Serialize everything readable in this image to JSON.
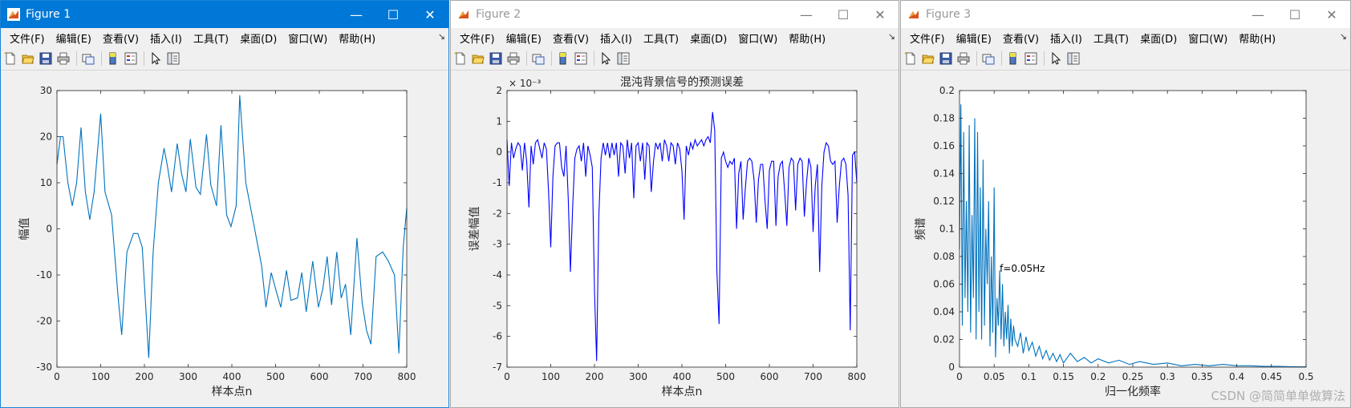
{
  "menu_labels": [
    "文件(F)",
    "编辑(E)",
    "查看(V)",
    "插入(I)",
    "工具(T)",
    "桌面(D)",
    "窗口(W)",
    "帮助(H)"
  ],
  "toolbar_icons": [
    "new-figure-icon",
    "open-file-icon",
    "save-icon",
    "print-icon",
    "link-plot-icon",
    "colorbar-icon",
    "legend-icon",
    "pointer-icon",
    "property-editor-icon"
  ],
  "colors": {
    "active_title": "#0078d7",
    "figure_bg": "#f0f0f0",
    "line_matlab": "#0072bd",
    "line_blue": "#0000ff"
  },
  "watermark": "CSDN @简简单单做算法",
  "windows": [
    {
      "title": "Figure 1",
      "active": true
    },
    {
      "title": "Figure 2",
      "active": false
    },
    {
      "title": "Figure 3",
      "active": false
    }
  ],
  "chart_data": [
    {
      "type": "line",
      "title": "",
      "xlabel": "样本点n",
      "ylabel": "幅值",
      "xlim": [
        0,
        800
      ],
      "ylim": [
        -30,
        30
      ],
      "xticks": [
        "0",
        "100",
        "200",
        "300",
        "400",
        "500",
        "600",
        "700",
        "800"
      ],
      "yticks": [
        "-30",
        "-20",
        "-10",
        "0",
        "10",
        "20",
        "30"
      ],
      "grid": false,
      "color": "#0072bd",
      "x": [
        0,
        8,
        14,
        25,
        35,
        45,
        55,
        65,
        75,
        85,
        100,
        110,
        125,
        140,
        148,
        160,
        175,
        185,
        195,
        210,
        220,
        232,
        245,
        252,
        262,
        275,
        285,
        295,
        305,
        318,
        328,
        342,
        352,
        365,
        375,
        388,
        398,
        410,
        418,
        432,
        450,
        468,
        478,
        490,
        500,
        512,
        525,
        535,
        550,
        560,
        570,
        585,
        598,
        608,
        618,
        628,
        640,
        650,
        660,
        672,
        686,
        698,
        708,
        718,
        730,
        745,
        758,
        772,
        782,
        792,
        800
      ],
      "y": [
        14,
        20,
        20,
        10,
        5,
        10,
        22,
        8,
        2,
        8,
        25,
        8,
        3,
        -15,
        -23,
        -5,
        -1,
        -1,
        -4,
        -28,
        -5,
        10,
        17.5,
        14,
        8,
        18.5,
        12,
        8,
        19.5,
        9,
        7.5,
        20.5,
        9.5,
        5,
        22.5,
        3,
        0.5,
        5,
        29,
        10,
        1,
        -8,
        -17,
        -9.5,
        -13,
        -17,
        -9,
        -15.5,
        -15,
        -9.5,
        -18,
        -7,
        -17,
        -13,
        -6,
        -16.5,
        -5,
        -15,
        -12,
        -23,
        -2,
        -16,
        -22,
        -25,
        -6,
        -5,
        -7,
        -10,
        -27,
        -4,
        4.5
      ]
    },
    {
      "type": "line",
      "title": "混沌背景信号的预测误差",
      "xlabel": "样本点n",
      "ylabel": "误差幅值",
      "exponent_label": "× 10⁻³",
      "xlim": [
        0,
        800
      ],
      "ylim": [
        -7,
        2
      ],
      "xticks": [
        "0",
        "100",
        "200",
        "300",
        "400",
        "500",
        "600",
        "700",
        "800"
      ],
      "yticks": [
        "-7",
        "-6",
        "-5",
        "-4",
        "-3",
        "-2",
        "-1",
        "0",
        "1",
        "2"
      ],
      "grid": false,
      "color": "#0000ff",
      "x": [
        0,
        5,
        10,
        15,
        20,
        25,
        30,
        35,
        40,
        45,
        50,
        55,
        60,
        65,
        70,
        75,
        80,
        85,
        90,
        95,
        100,
        105,
        110,
        115,
        120,
        125,
        130,
        135,
        140,
        145,
        150,
        155,
        160,
        165,
        170,
        175,
        180,
        185,
        190,
        195,
        200,
        205,
        210,
        215,
        220,
        225,
        230,
        235,
        240,
        245,
        250,
        255,
        260,
        265,
        270,
        275,
        280,
        285,
        290,
        295,
        300,
        305,
        310,
        315,
        320,
        325,
        330,
        335,
        340,
        345,
        350,
        355,
        360,
        365,
        370,
        375,
        380,
        385,
        390,
        395,
        400,
        405,
        410,
        415,
        420,
        425,
        430,
        435,
        440,
        445,
        450,
        455,
        460,
        465,
        470,
        475,
        480,
        485,
        490,
        495,
        500,
        505,
        510,
        515,
        520,
        525,
        530,
        535,
        540,
        545,
        550,
        555,
        560,
        565,
        570,
        575,
        580,
        585,
        590,
        595,
        600,
        605,
        610,
        615,
        620,
        625,
        630,
        635,
        640,
        645,
        650,
        655,
        660,
        665,
        670,
        675,
        680,
        685,
        690,
        695,
        700,
        705,
        710,
        715,
        720,
        725,
        730,
        735,
        740,
        745,
        750,
        755,
        760,
        765,
        770,
        775,
        780,
        785,
        790,
        795,
        800
      ],
      "y": [
        0.4,
        -1.1,
        0.3,
        -0.2,
        0.1,
        0.3,
        0.2,
        -0.6,
        0.3,
        -0.3,
        -1.8,
        0.2,
        -0.4,
        0.3,
        0.4,
        0.1,
        -0.2,
        0.3,
        0.1,
        -1.3,
        -3.1,
        -0.8,
        0.2,
        0.3,
        0.3,
        -0.5,
        -0.8,
        0.2,
        -1.5,
        -3.9,
        -1.8,
        -0.2,
        0.1,
        0.2,
        -0.3,
        0.3,
        -0.8,
        0.2,
        -0.1,
        -0.5,
        -4.5,
        -6.8,
        -2.1,
        -0.2,
        0.3,
        -0.1,
        0.3,
        -0.2,
        0.3,
        -0.1,
        0.3,
        -0.8,
        0.3,
        0.2,
        -0.7,
        0.4,
        -0.2,
        0.3,
        -1.5,
        0.2,
        0.3,
        -0.3,
        0.3,
        -0.9,
        0.3,
        0.2,
        -1.3,
        -0.3,
        0.3,
        0.1,
        0.3,
        -0.3,
        0.4,
        0.2,
        -0.3,
        0.3,
        0.2,
        -0.4,
        0.3,
        0.1,
        -0.6,
        -2.2,
        0.2,
        -0.1,
        0.3,
        0.1,
        0.4,
        0.2,
        0.3,
        0.4,
        0.2,
        0.4,
        0.5,
        0.3,
        1.3,
        0.7,
        -3.9,
        -5.6,
        -0.2,
        0.0,
        -0.3,
        -0.5,
        -0.3,
        -0.4,
        -0.2,
        -2.5,
        -0.7,
        -0.3,
        -2.2,
        -1.2,
        -0.3,
        -0.2,
        -0.3,
        -0.9,
        -2.3,
        -0.9,
        -0.4,
        -0.4,
        -1.6,
        -2.5,
        -0.6,
        -0.3,
        -0.3,
        -2.4,
        -0.8,
        -0.4,
        -0.3,
        -1.3,
        -2.4,
        -0.5,
        -0.2,
        -0.3,
        -1.9,
        -0.4,
        -0.2,
        -0.3,
        -2.1,
        -1.0,
        -0.2,
        -0.5,
        -2.6,
        -1.1,
        -0.4,
        -3.9,
        -1.1,
        0.0,
        0.3,
        0.2,
        -0.3,
        -0.4,
        -0.3,
        -2.3,
        -1.1,
        -0.3,
        -0.2,
        -0.4,
        -1.4,
        -5.8,
        -0.1,
        0.0,
        -1.0
      ]
    },
    {
      "type": "line",
      "title": "",
      "xlabel": "归一化频率",
      "ylabel": "频谱",
      "annotation": "f=0.05Hz",
      "xlim": [
        0,
        0.5
      ],
      "ylim": [
        0,
        0.2
      ],
      "xticks": [
        "0",
        "0.05",
        "0.1",
        "0.15",
        "0.2",
        "0.25",
        "0.3",
        "0.35",
        "0.4",
        "0.45",
        "0.5"
      ],
      "yticks": [
        "0",
        "0.02",
        "0.04",
        "0.06",
        "0.08",
        "0.1",
        "0.12",
        "0.14",
        "0.16",
        "0.18",
        "0.2"
      ],
      "grid": false,
      "color": "#0072bd",
      "x": [
        0,
        0.002,
        0.004,
        0.006,
        0.008,
        0.01,
        0.012,
        0.014,
        0.016,
        0.018,
        0.02,
        0.022,
        0.024,
        0.026,
        0.028,
        0.03,
        0.032,
        0.034,
        0.036,
        0.038,
        0.04,
        0.042,
        0.044,
        0.046,
        0.048,
        0.05,
        0.052,
        0.054,
        0.056,
        0.058,
        0.06,
        0.062,
        0.064,
        0.066,
        0.068,
        0.07,
        0.072,
        0.074,
        0.076,
        0.078,
        0.08,
        0.084,
        0.088,
        0.092,
        0.096,
        0.1,
        0.105,
        0.11,
        0.115,
        0.12,
        0.125,
        0.13,
        0.135,
        0.14,
        0.145,
        0.15,
        0.16,
        0.17,
        0.18,
        0.19,
        0.2,
        0.215,
        0.23,
        0.245,
        0.26,
        0.28,
        0.3,
        0.32,
        0.34,
        0.36,
        0.38,
        0.4,
        0.42,
        0.44,
        0.46,
        0.48,
        0.5
      ],
      "y": [
        0.085,
        0.19,
        0.03,
        0.17,
        0.05,
        0.12,
        0.04,
        0.175,
        0.025,
        0.11,
        0.05,
        0.18,
        0.02,
        0.17,
        0.04,
        0.13,
        0.02,
        0.15,
        0.03,
        0.1,
        0.06,
        0.12,
        0.015,
        0.08,
        0.025,
        0.13,
        0.007,
        0.05,
        0.03,
        0.07,
        0.02,
        0.06,
        0.015,
        0.04,
        0.02,
        0.045,
        0.01,
        0.035,
        0.015,
        0.03,
        0.02,
        0.015,
        0.025,
        0.01,
        0.022,
        0.012,
        0.018,
        0.008,
        0.015,
        0.006,
        0.012,
        0.005,
        0.01,
        0.004,
        0.009,
        0.003,
        0.01,
        0.004,
        0.007,
        0.003,
        0.006,
        0.003,
        0.005,
        0.002,
        0.004,
        0.002,
        0.003,
        0.001,
        0.002,
        0.001,
        0.002,
        0.001,
        0.001,
        0.0005,
        0.0005,
        0.0003,
        0.0002
      ]
    }
  ]
}
